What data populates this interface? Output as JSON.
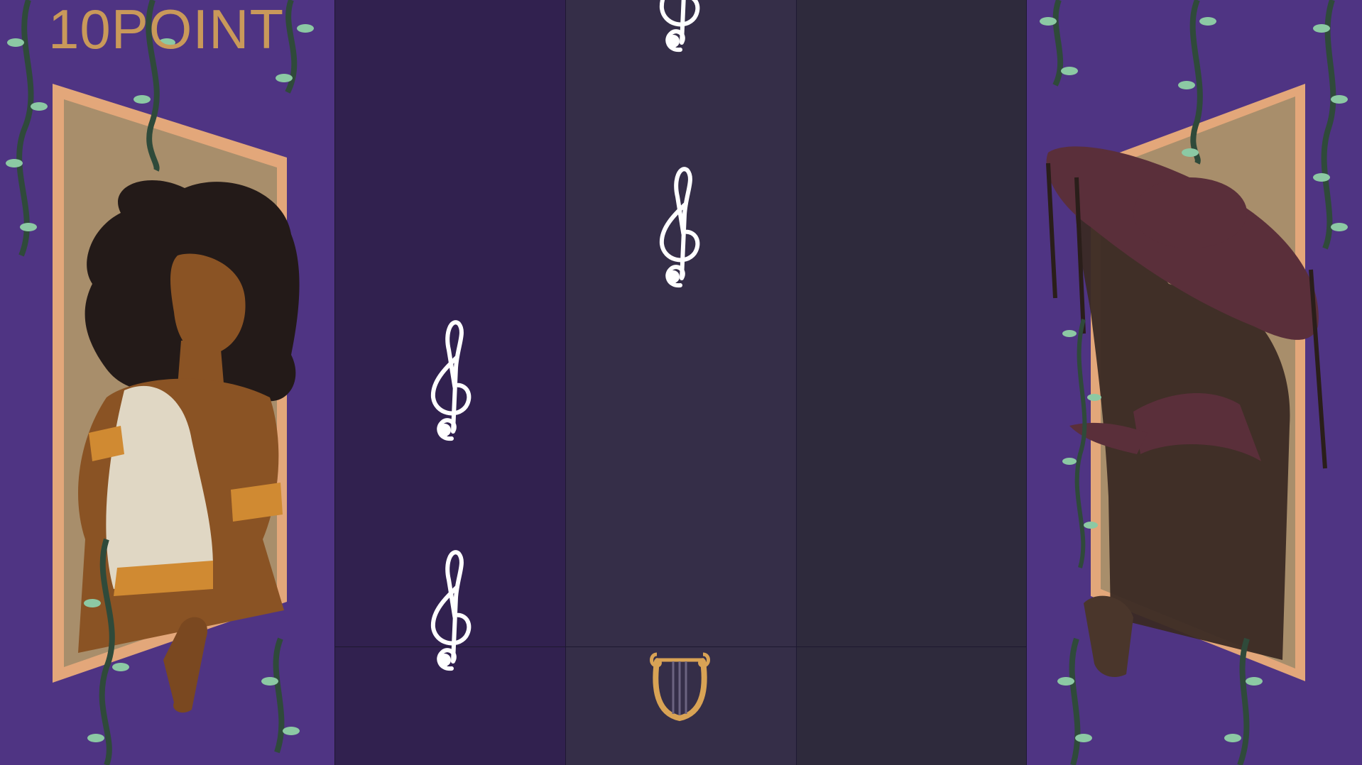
{
  "hud": {
    "score_text": "10POINT"
  },
  "lanes": [
    {
      "name": "lane-left",
      "color": "#31214f"
    },
    {
      "name": "lane-middle",
      "color": "#352e48"
    },
    {
      "name": "lane-right",
      "color": "#2e2a3c"
    }
  ],
  "notes": [
    {
      "lane": 2,
      "icon": "treble-clef-icon"
    },
    {
      "lane": 2,
      "icon": "treble-clef-icon"
    },
    {
      "lane": 1,
      "icon": "treble-clef-icon"
    },
    {
      "lane": 1,
      "icon": "treble-clef-icon"
    }
  ],
  "player": {
    "icon": "lyre-icon",
    "lane": 2
  },
  "characters": [
    {
      "name": "orpheus-portrait",
      "side": "left"
    },
    {
      "name": "hooded-figure-portrait",
      "side": "right"
    }
  ],
  "colors": {
    "background": "#4f3483",
    "score": "#c9995a",
    "frame": "#e3a77a",
    "vine": "#2f4a3a",
    "leaf": "#8cc9a4",
    "lyre": "#d9a355"
  }
}
